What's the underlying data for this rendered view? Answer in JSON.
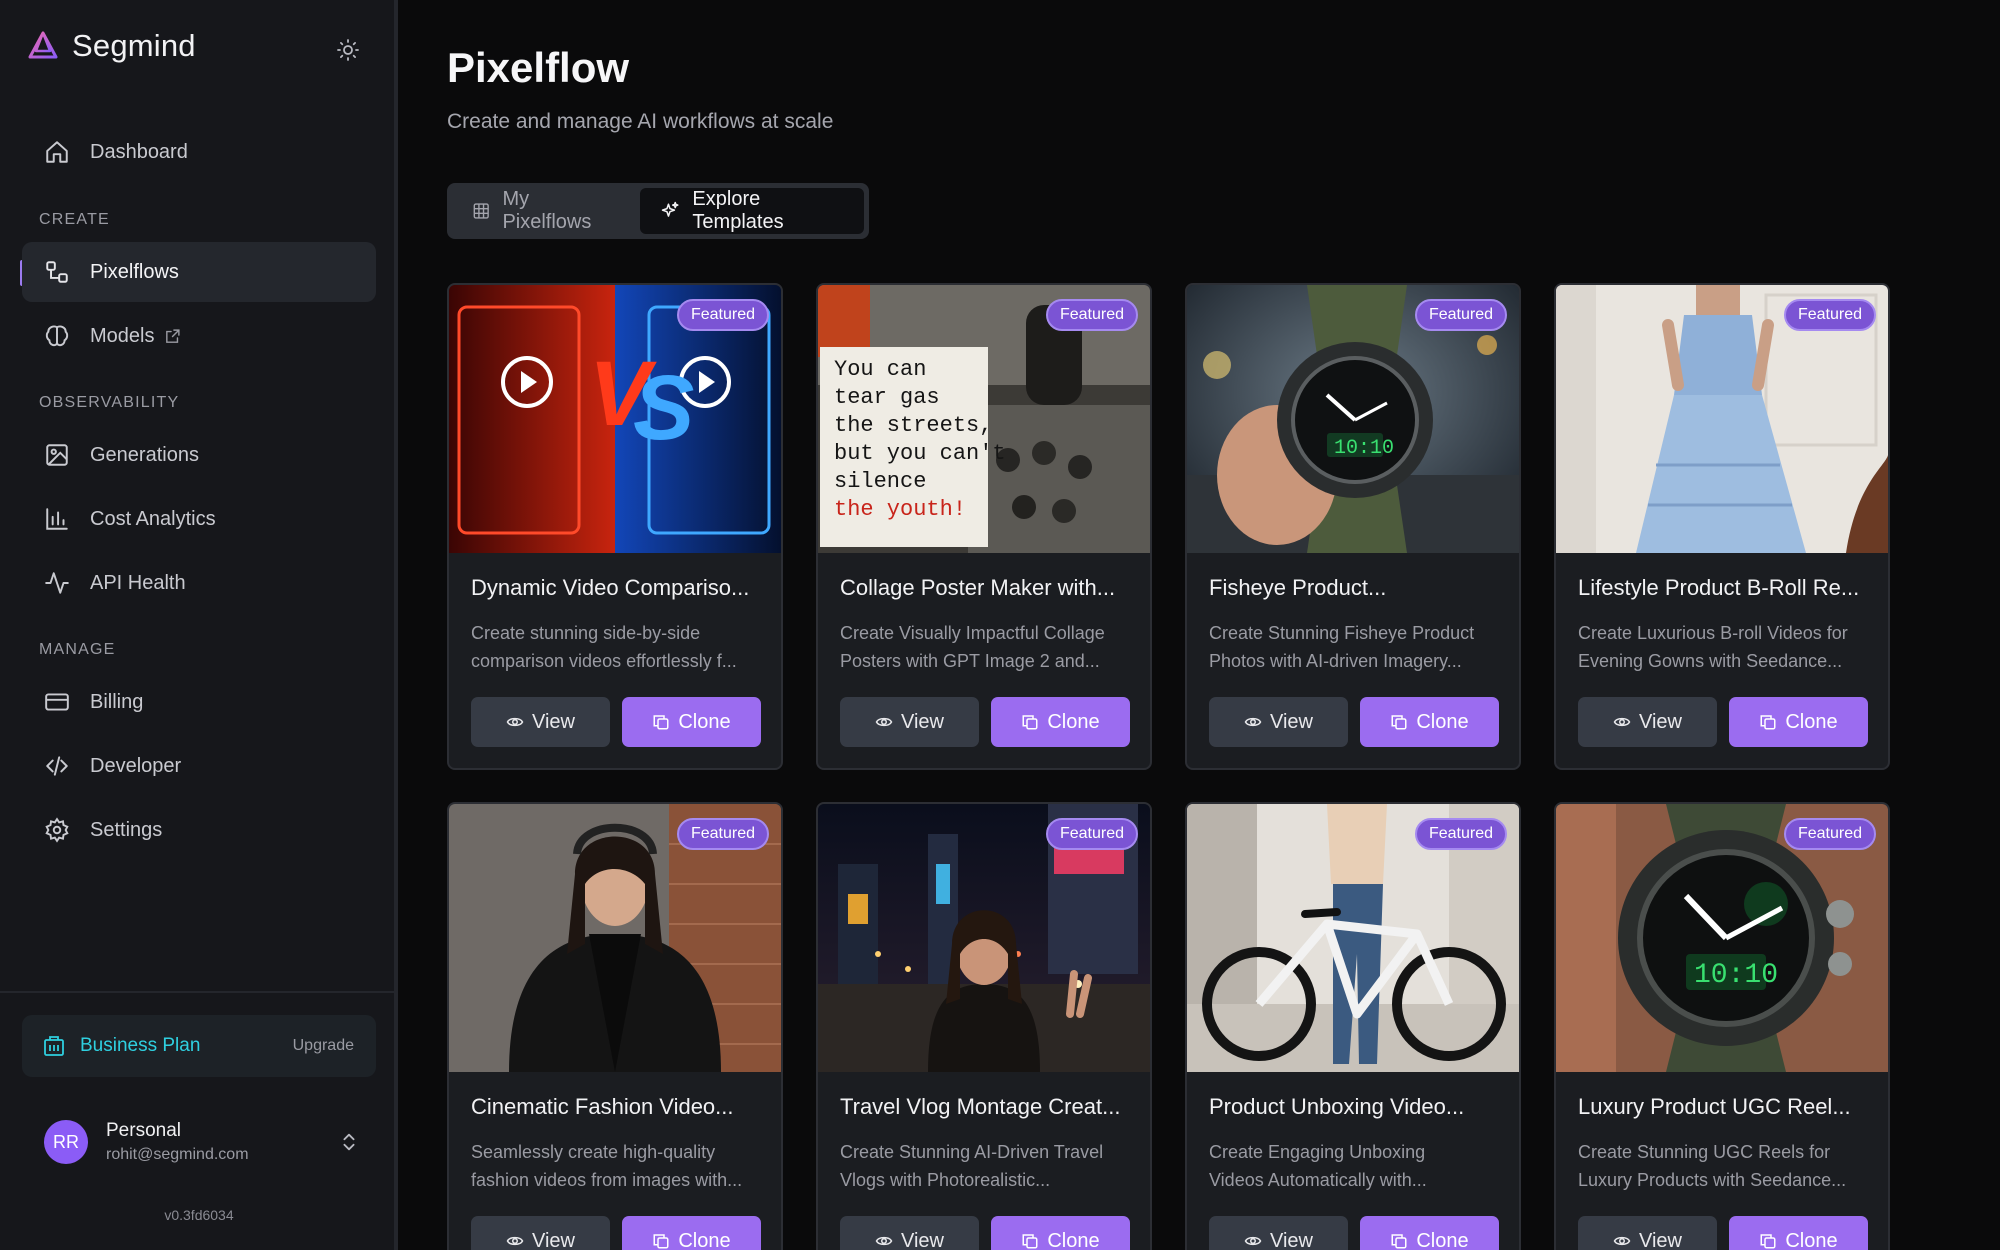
{
  "app": {
    "name": "Segmind"
  },
  "nav": {
    "dashboard": "Dashboard",
    "create_header": "CREATE",
    "pixelflows": "Pixelflows",
    "models": "Models",
    "observability_header": "OBSERVABILITY",
    "generations": "Generations",
    "cost_analytics": "Cost Analytics",
    "api_health": "API Health",
    "manage_header": "MANAGE",
    "billing": "Billing",
    "developer": "Developer",
    "settings": "Settings"
  },
  "plan": {
    "name": "Business Plan",
    "action": "Upgrade"
  },
  "user": {
    "initials": "RR",
    "name": "Personal",
    "email": "rohit@segmind.com"
  },
  "version": "v0.3fd6034",
  "page": {
    "title": "Pixelflow",
    "subtitle": "Create and manage AI workflows at scale"
  },
  "tabs": {
    "my": "My Pixelflows",
    "explore": "Explore Templates",
    "active": "Explore Templates"
  },
  "card_actions": {
    "view": "View",
    "clone": "Clone",
    "badge": "Featured"
  },
  "cards": [
    {
      "title": "Dynamic Video Compariso...",
      "desc_1": "Create stunning side-by-side",
      "desc_2": "comparison videos effortlessly f..."
    },
    {
      "title": "Collage Poster Maker with...",
      "desc_1": "Create Visually Impactful Collage",
      "desc_2": "Posters with GPT Image 2 and...",
      "poster_text": [
        "You can",
        "tear gas",
        "the streets,",
        "but you can't",
        "silence",
        "the youth!"
      ]
    },
    {
      "title": "Fisheye Product...",
      "desc_1": "Create Stunning Fisheye Product",
      "desc_2": "Photos with AI-driven Imagery..."
    },
    {
      "title": "Lifestyle Product B-Roll Re...",
      "desc_1": "Create Luxurious B-roll Videos for",
      "desc_2": "Evening Gowns with Seedance..."
    },
    {
      "title": "Cinematic Fashion Video...",
      "desc_1": "Seamlessly create high-quality",
      "desc_2": "fashion videos from images with..."
    },
    {
      "title": "Travel Vlog Montage Creat...",
      "desc_1": "Create Stunning AI-Driven Travel",
      "desc_2": "Vlogs with Photorealistic..."
    },
    {
      "title": "Product Unboxing Video...",
      "desc_1": "Create Engaging Unboxing",
      "desc_2": "Videos Automatically with..."
    },
    {
      "title": "Luxury Product UGC Reel...",
      "desc_1": "Create Stunning UGC Reels for",
      "desc_2": "Luxury Products with Seedance..."
    }
  ],
  "colors": {
    "accent": "#9b6cf0",
    "badge": "#7b54d4",
    "plan": "#2fd0e0",
    "background": "#0a0a0b",
    "sidebar": "#16171b"
  }
}
